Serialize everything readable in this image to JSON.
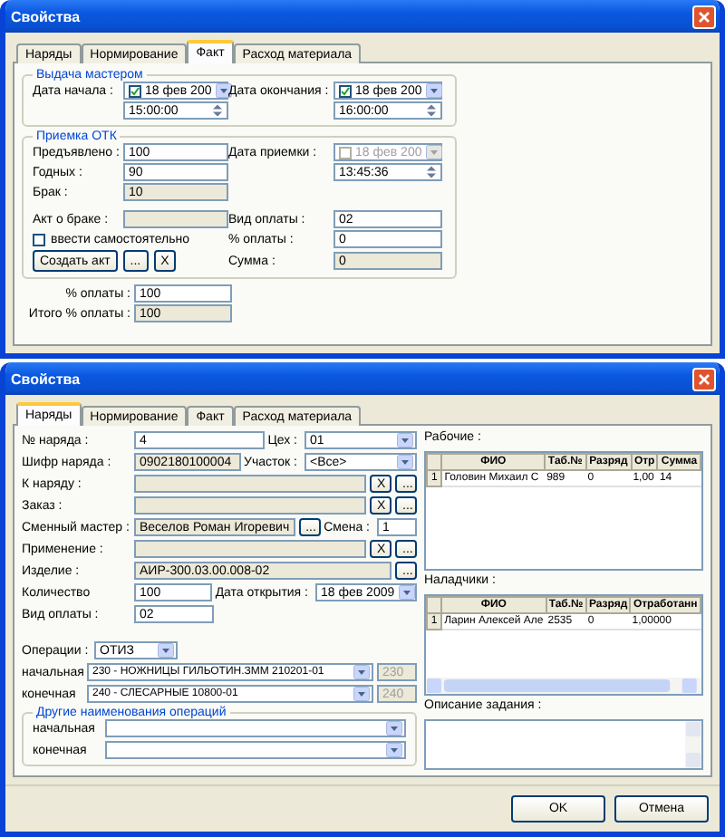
{
  "fact_window": {
    "title": "Свойства",
    "tabs": [
      {
        "label": "Наряды",
        "selected": false
      },
      {
        "label": "Нормирование",
        "selected": false
      },
      {
        "label": "Факт",
        "selected": true
      },
      {
        "label": "Расход материала",
        "selected": false
      }
    ],
    "master_group": {
      "title": "Выдача мастером",
      "dates": [
        {
          "label": "Дата начала :",
          "date": "18 фев 200",
          "checked": true,
          "disabled": false,
          "time": "15:00:00"
        },
        {
          "label": "Дата окончания :",
          "date": "18 фев 200",
          "checked": true,
          "disabled": false,
          "time": "16:00:00"
        }
      ]
    },
    "otk_group": {
      "title": "Приемка ОТК",
      "counts": [
        {
          "label": "Предъявлено :",
          "value": "100",
          "disabled": false
        },
        {
          "label": "Годных :",
          "value": "90",
          "disabled": false
        },
        {
          "label": "Брак :",
          "value": "10",
          "disabled": true
        }
      ],
      "accept": {
        "label": "Дата приемки :",
        "date": "18 фев 200",
        "checked": false,
        "disabled": true,
        "time": "13:45:36"
      },
      "act": {
        "label": "Акт о браке :",
        "disabled": true
      },
      "manual": {
        "label": "ввести самостоятельно",
        "checked": false
      },
      "buttons": [
        "Создать акт",
        "...",
        "X"
      ],
      "payment": [
        {
          "label": "Вид оплаты :",
          "value": "02",
          "disabled": false
        },
        {
          "label": "% оплаты :",
          "value": "0",
          "disabled": false
        },
        {
          "label": "Сумма :",
          "value": "0",
          "disabled": true
        }
      ]
    },
    "totals": [
      {
        "label": "% оплаты :",
        "value": "100",
        "disabled": false
      },
      {
        "label": "Итого % оплаты :",
        "value": "100",
        "disabled": true
      }
    ]
  },
  "orders_window": {
    "title": "Свойства",
    "tabs": [
      {
        "label": "Наряды",
        "selected": true
      },
      {
        "label": "Нормирование",
        "selected": false
      },
      {
        "label": "Факт",
        "selected": false
      },
      {
        "label": "Расход материала",
        "selected": false
      }
    ],
    "rows": [
      {
        "label": "№ наряда :",
        "field": {
          "kind": "text",
          "value": "4",
          "disabled": false
        },
        "extra": {
          "label": "Цех :",
          "field": {
            "kind": "combo",
            "value": "01",
            "disabled": false
          }
        }
      },
      {
        "label": "Шифр наряда :",
        "field": {
          "kind": "text",
          "value": "0902180100004",
          "disabled": true
        },
        "extra": {
          "label": "Участок :",
          "field": {
            "kind": "combo",
            "value": "<Все>",
            "disabled": false
          }
        }
      },
      {
        "label": "К наряду :",
        "field": {
          "kind": "text",
          "disabled": true
        },
        "buttons": [
          "X",
          "..."
        ]
      },
      {
        "label": "Заказ :",
        "field": {
          "kind": "text",
          "disabled": true
        },
        "buttons": [
          "X",
          "..."
        ]
      },
      {
        "label": "Сменный мастер :",
        "field": {
          "kind": "text",
          "value": "Веселов Роман Игоревич",
          "disabled": true
        },
        "buttons": [
          "..."
        ],
        "extra": {
          "label": "Смена :",
          "field": {
            "kind": "text",
            "value": "1",
            "disabled": false
          }
        }
      },
      {
        "label": "Применение :",
        "field": {
          "kind": "text",
          "disabled": true
        },
        "buttons": [
          "X",
          "..."
        ]
      },
      {
        "label": "Изделие :",
        "field": {
          "kind": "text",
          "value": "АИР-300.03.00.008-02",
          "disabled": true
        },
        "buttons": [
          "..."
        ]
      },
      {
        "label": "Количество",
        "field": {
          "kind": "text",
          "value": "100",
          "disabled": false
        },
        "extra": {
          "label": "Дата открытия :",
          "field": {
            "kind": "date",
            "value": "18 фев 2009",
            "disabled": false
          }
        }
      },
      {
        "label": "Вид оплаты :",
        "field": {
          "kind": "text",
          "value": "02",
          "disabled": false
        }
      }
    ],
    "operations": {
      "label": "Операции :",
      "value": "ОТИЗ",
      "range": [
        {
          "label": "начальная",
          "value": "230 - НОЖНИЦЫ ГИЛЬОТИН.ЗММ 210201-01",
          "code": "230"
        },
        {
          "label": "конечная",
          "value": "240 - СЛЕСАРНЫЕ 10800-01",
          "code": "240"
        }
      ]
    },
    "other_ops": {
      "title": "Другие наименования операций",
      "rows": [
        {
          "label": "начальная"
        },
        {
          "label": "конечная"
        }
      ]
    },
    "workers": {
      "title": "Рабочие :",
      "columns": [
        "ФИО",
        "Таб.№",
        "Разряд",
        "Отр",
        "Сумма"
      ],
      "rows": [
        {
          "number": "1",
          "cells": [
            "Головин Михаил С",
            "989",
            "0",
            "1,00",
            "14"
          ]
        }
      ]
    },
    "adjusters": {
      "title": "Наладчики :",
      "columns": [
        "ФИО",
        "Таб.№",
        "Разряд",
        "Отработанн"
      ],
      "rows": [
        {
          "number": "1",
          "cells": [
            "Ларин Алексей Але",
            "2535",
            "0",
            "1,00000"
          ]
        }
      ]
    },
    "description": {
      "label": "Описание задания :"
    },
    "buttons": [
      "OK",
      "Отмена"
    ]
  }
}
